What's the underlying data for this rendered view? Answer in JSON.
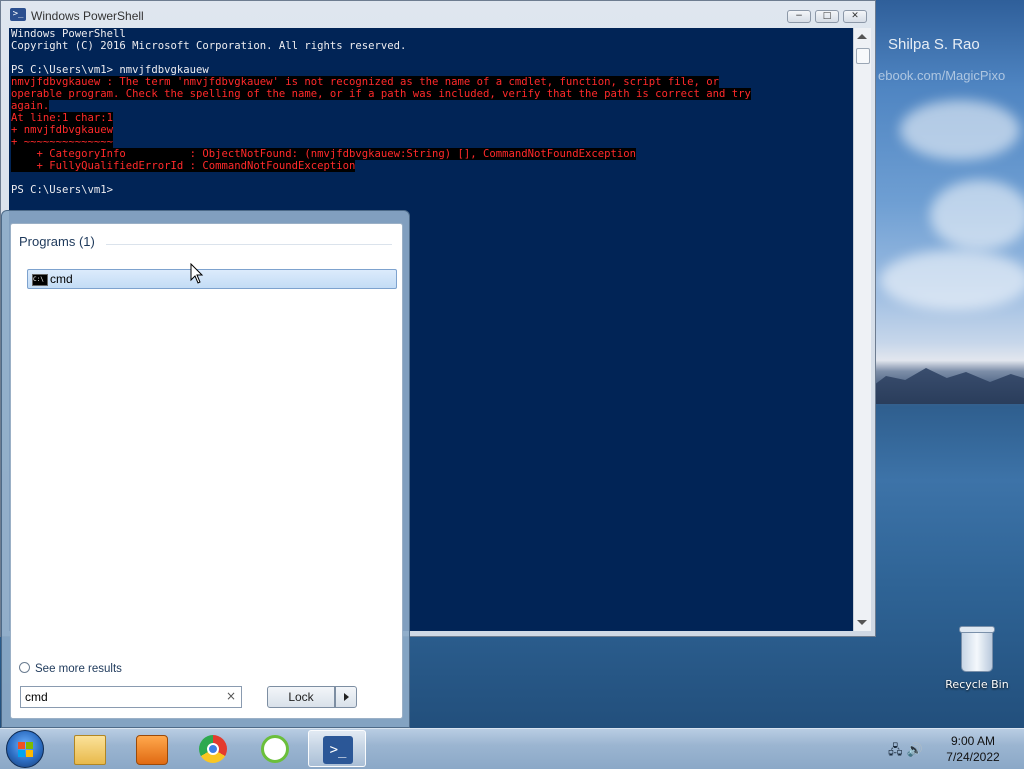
{
  "desktop": {
    "watermark": "Shilpa S. Rao",
    "watermark_url": "ebook.com/MagicPixo",
    "recycle_bin_label": "Recycle Bin"
  },
  "powershell": {
    "title": "Windows PowerShell",
    "controls": {
      "minimize": "−",
      "maximize": "□",
      "close": "✕"
    },
    "lines": [
      {
        "text": "Windows PowerShell",
        "error": false
      },
      {
        "text": "Copyright (C) 2016 Microsoft Corporation. All rights reserved.",
        "error": false
      },
      {
        "text": "",
        "error": false
      },
      {
        "text": "PS C:\\Users\\vm1> nmvjfdbvgkauew",
        "error": false
      },
      {
        "text": "nmvjfdbvgkauew : The term 'nmvjfdbvgkauew' is not recognized as the name of a cmdlet, function, script file, or",
        "error": true
      },
      {
        "text": "operable program. Check the spelling of the name, or if a path was included, verify that the path is correct and try",
        "error": true
      },
      {
        "text": "again.",
        "error": true
      },
      {
        "text": "At line:1 char:1",
        "error": true
      },
      {
        "text": "+ nmvjfdbvgkauew",
        "error": true
      },
      {
        "text": "+ ~~~~~~~~~~~~~~",
        "error": true
      },
      {
        "text": "    + CategoryInfo          : ObjectNotFound: (nmvjfdbvgkauew:String) [], CommandNotFoundException",
        "error": true
      },
      {
        "text": "    + FullyQualifiedErrorId : CommandNotFoundException",
        "error": true
      },
      {
        "text": "",
        "error": false
      },
      {
        "text": "PS C:\\Users\\vm1>",
        "error": false
      }
    ]
  },
  "start_menu": {
    "programs_header": "Programs (1)",
    "results": [
      {
        "label": "cmd",
        "icon": "cmd-icon"
      }
    ],
    "see_more": "See more results",
    "search_value": "cmd",
    "clear_glyph": "×",
    "power_button": "Lock"
  },
  "taskbar": {
    "items": [
      "explorer",
      "media-player",
      "chrome",
      "greenshot",
      "powershell"
    ],
    "clock_time": "9:00 AM",
    "clock_date": "7/24/2022"
  },
  "colors": {
    "console_bg": "#012456",
    "console_fg": "#eeedf0",
    "error_fg": "#ff2a2a"
  }
}
